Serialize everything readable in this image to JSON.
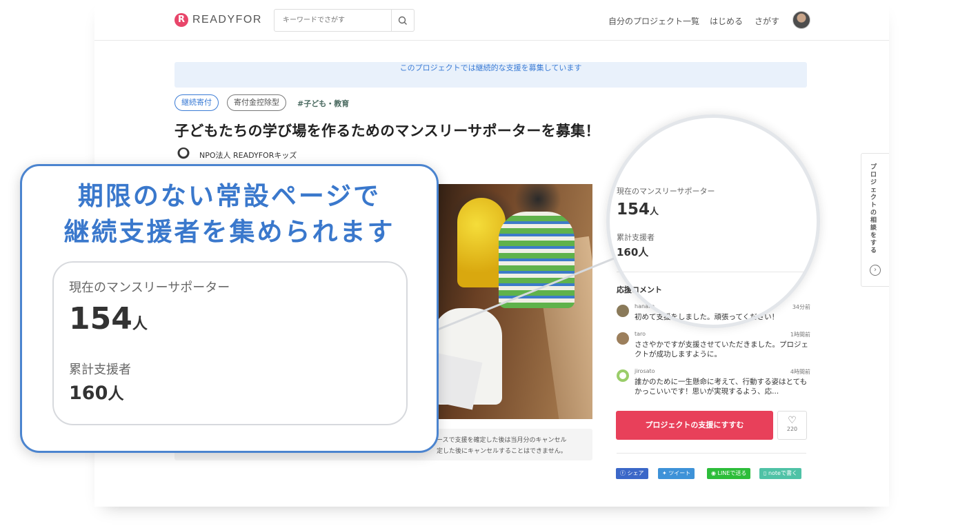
{
  "header": {
    "logo_text": "READYFOR",
    "search_placeholder": "キーワードでさがす",
    "nav": [
      "自分のプロジェクト一覧",
      "はじめる",
      "さがす"
    ]
  },
  "banner": "このプロジェクトでは継続的な支援を募集しています",
  "tags": [
    "継続寄付",
    "寄付金控除型",
    "#子ども・教育"
  ],
  "project": {
    "title": "子どもたちの学び場を作るためのマンスリーサポーターを募集！",
    "org": "NPO法人 READYFORキッズ",
    "caption_line1": "ースで支援を確定した後は当月分のキャンセル",
    "caption_line2": "定した後にキャンセルすることはできません。"
  },
  "sidebar": {
    "monthly_label": "現在のマンスリーサポーター",
    "monthly_value": "154",
    "monthly_unit": "人",
    "total_label": "累計支援者",
    "total_value": "160人",
    "comments_title": "応援コメント",
    "comments": [
      {
        "user": "hanako",
        "time": "34分前",
        "text": "初めて支援をしました。頑張ってください！",
        "color": "#8a7a5a"
      },
      {
        "user": "taro",
        "time": "1時間前",
        "text": "ささやかですが支援させていただきました。プロジェクトが成功しますように。",
        "color": "#9c7f5c"
      },
      {
        "user": "jirosato",
        "time": "4時間前",
        "text": "誰かのために一生懸命に考えて、行動する姿はとてもかっこいいです！思いが実現するよう、応...",
        "color": "#9acd6a"
      }
    ],
    "cta_label": "プロジェクトの支援にすすむ",
    "like_count": "220",
    "share": [
      {
        "label": "シェア",
        "color": "#3b67c8"
      },
      {
        "label": "ツイート",
        "color": "#3e92d8"
      },
      {
        "label": "LINEで送る",
        "color": "#2dbd3a"
      },
      {
        "label": "noteで書く",
        "color": "#4fc2a6"
      }
    ]
  },
  "side_tab": {
    "label": "プロジェクトの相談をする",
    "arrow": "›"
  },
  "callout": {
    "title_line1": "期限のない常設ページで",
    "title_line2": "継続支援者を集められます",
    "monthly_label": "現在のマンスリーサポーター",
    "monthly_value": "154",
    "monthly_unit": "人",
    "total_label": "累計支援者",
    "total_value": "160",
    "total_unit": "人"
  }
}
